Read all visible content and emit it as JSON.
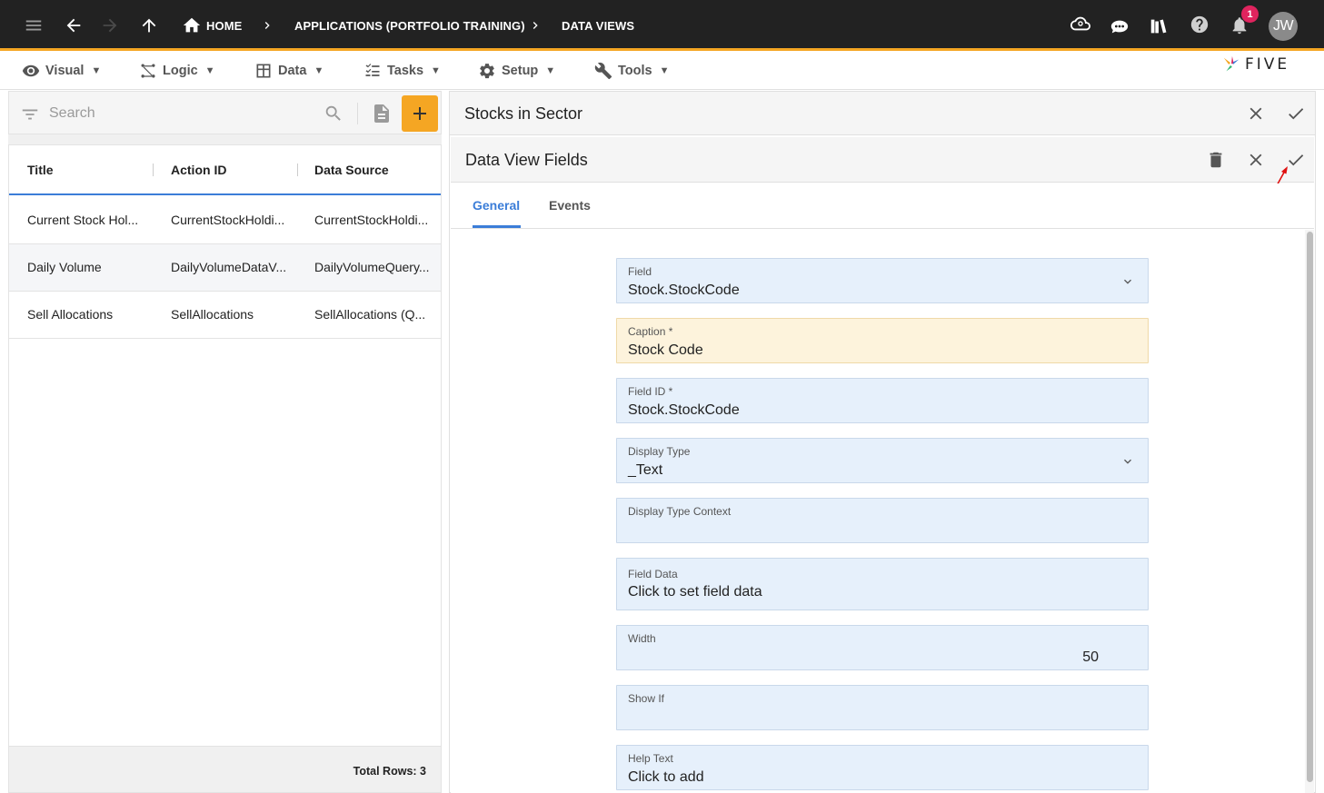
{
  "topbar": {
    "breadcrumbs": [
      {
        "label": "HOME"
      },
      {
        "label": "APPLICATIONS (PORTFOLIO TRAINING)"
      },
      {
        "label": "DATA VIEWS"
      }
    ],
    "notification_count": "1",
    "avatar_initials": "JW",
    "accent_color": "#f5a623"
  },
  "menu": {
    "items": [
      {
        "label": "Visual",
        "icon": "eye-icon"
      },
      {
        "label": "Logic",
        "icon": "logic-icon"
      },
      {
        "label": "Data",
        "icon": "table-icon"
      },
      {
        "label": "Tasks",
        "icon": "tasks-icon"
      },
      {
        "label": "Setup",
        "icon": "gear-icon"
      },
      {
        "label": "Tools",
        "icon": "tools-icon"
      }
    ],
    "caret": "▼",
    "logo_text": "FIVE"
  },
  "list": {
    "search_placeholder": "Search",
    "columns": [
      "Title",
      "Action ID",
      "Data Source"
    ],
    "rows": [
      [
        "Current Stock Hol...",
        "CurrentStockHoldi...",
        "CurrentStockHoldi..."
      ],
      [
        "Daily Volume",
        "DailyVolumeDataV...",
        "DailyVolumeQuery..."
      ],
      [
        "Sell Allocations",
        "SellAllocations",
        "SellAllocations (Q..."
      ]
    ],
    "total_rows": "Total Rows: 3"
  },
  "panel": {
    "title": "Stocks in Sector",
    "sub_title": "Data View Fields",
    "tabs": [
      "General",
      "Events"
    ],
    "active_tab": "General",
    "link_color": "#3b7dd8"
  },
  "form": {
    "fields": [
      {
        "label": "Field",
        "value": "Stock.StockCode",
        "dropdown": true,
        "required": false
      },
      {
        "label": "Caption *",
        "value": "Stock Code",
        "dropdown": false,
        "required": true
      },
      {
        "label": "Field ID *",
        "value": "Stock.StockCode",
        "dropdown": false,
        "required": false
      },
      {
        "label": "Display Type",
        "value": "_Text",
        "dropdown": true,
        "required": false
      },
      {
        "label": "Display Type Context",
        "value": "",
        "dropdown": false,
        "required": false
      },
      {
        "label": "Field Data",
        "value": "Click to set field data",
        "dropdown": false,
        "required": false
      },
      {
        "label": "Width",
        "value": "50",
        "dropdown": false,
        "required": false
      },
      {
        "label": "Show If",
        "value": "",
        "dropdown": false,
        "required": false
      },
      {
        "label": "Help Text",
        "value": "Click to add",
        "dropdown": false,
        "required": false
      }
    ]
  }
}
